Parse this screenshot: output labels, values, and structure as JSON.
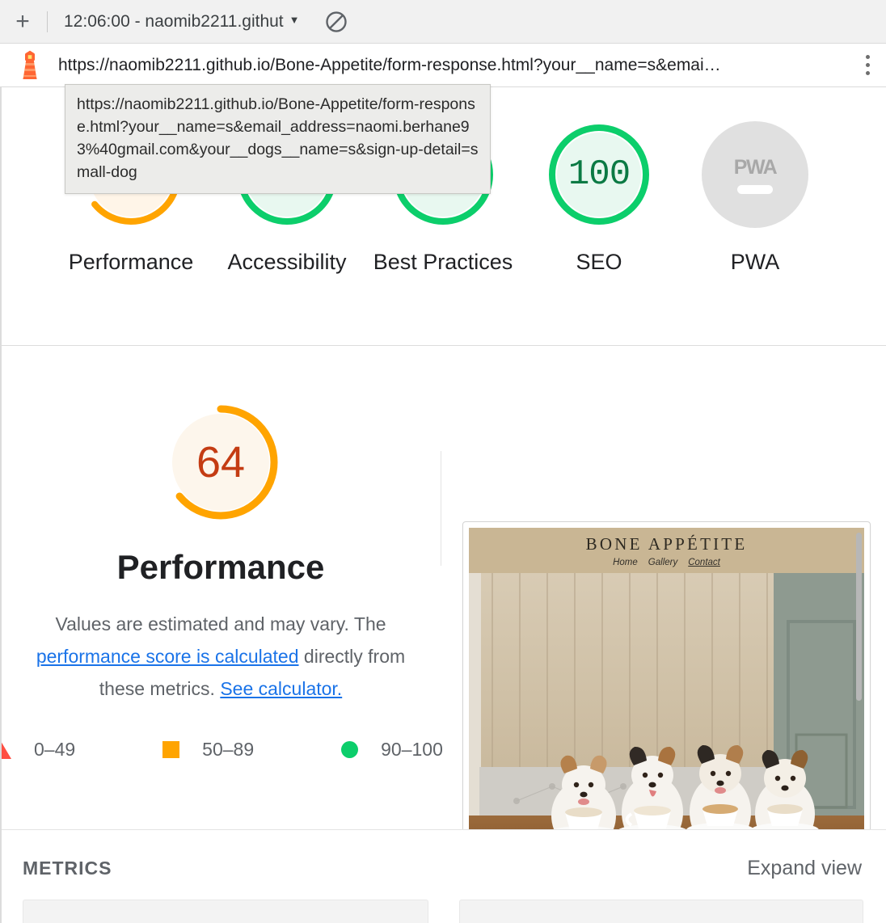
{
  "browser": {
    "new_tab_label": "+",
    "tab_title": "12:06:00 - naomib2211.githut",
    "tab_caret": "▼",
    "block_icon_name": "no-entry-icon",
    "url": "https://naomib2211.github.io/Bone-Appetite/form-response.html?your__name=s&emai…",
    "kebab_label": "⋮"
  },
  "tooltip": {
    "text": "https://naomib2211.github.io/Bone-Appetite/form-response.html?your__name=s&email_address=naomi.berhane93%40gmail.com&your__dogs__name=s&sign-up-detail=small-dog"
  },
  "scores": {
    "items": [
      {
        "label": "Performance",
        "value": "64",
        "color": "#ffa400",
        "fill": "#fff5e8",
        "text_color": "#c43c13",
        "percent": 64
      },
      {
        "label": "Accessibility",
        "value": "",
        "color": "#0cce6b",
        "fill": "#e8f8f0",
        "text_color": "#0b7a44",
        "percent": 100
      },
      {
        "label": "Best Practices",
        "value": "",
        "color": "#0cce6b",
        "fill": "#e8f8f0",
        "text_color": "#0b7a44",
        "percent": 100
      },
      {
        "label": "SEO",
        "value": "100",
        "color": "#0cce6b",
        "fill": "#e8f8f0",
        "text_color": "#0b7a44",
        "percent": 100
      },
      {
        "label": "PWA",
        "value": "—",
        "color": "#e0e0e0",
        "fill": "#e0e0e0",
        "text_color": "#a8a8a8",
        "percent": 0
      }
    ],
    "pwa_badge": "PWA"
  },
  "performance": {
    "score": "64",
    "score_percent": 64,
    "arc_color": "#ffa400",
    "fill_color": "#fdf6ec",
    "score_text_color": "#c43c13",
    "heading": "Performance",
    "desc_part1": "Values are estimated and may vary. The ",
    "desc_link1": "performance score is calculated",
    "desc_part2": " directly from these metrics. ",
    "desc_link2": "See calculator.",
    "legend": [
      {
        "marker": "triangle-icon",
        "color": "#ff4e42",
        "label": "0–49"
      },
      {
        "marker": "square-icon",
        "color": "#ffa400",
        "label": "50–89"
      },
      {
        "marker": "circle-icon",
        "color": "#0cce6b",
        "label": "90–100"
      }
    ]
  },
  "thumbnail": {
    "site_title": "BONE APPÉTITE",
    "nav": [
      "Home",
      "Gallery",
      "Contact"
    ],
    "nav_active": "Contact",
    "alt": "Four Jack Russell terriers sitting at a wooden table with coffee cups in front of a wood-panelled wall"
  },
  "metrics": {
    "section_label": "METRICS",
    "expand_view": "Expand view"
  }
}
